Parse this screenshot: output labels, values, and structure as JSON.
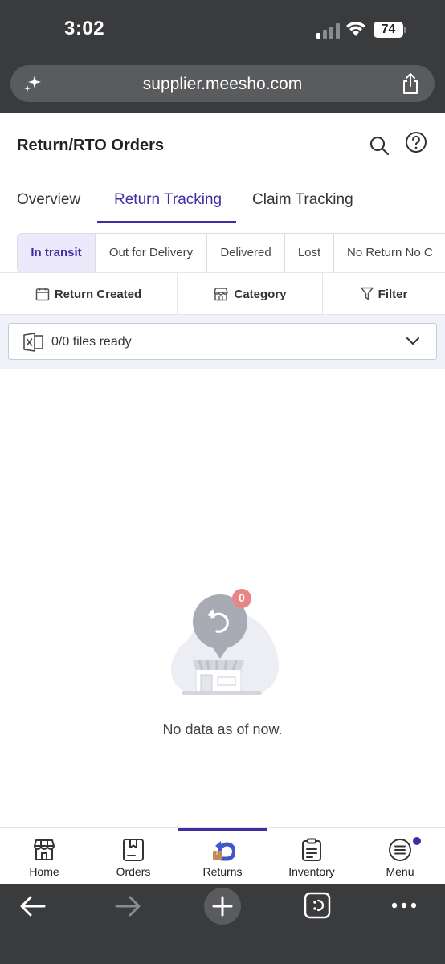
{
  "status_bar": {
    "time": "3:02",
    "battery": "74"
  },
  "browser": {
    "url": "supplier.meesho.com"
  },
  "header": {
    "title": "Return/RTO Orders"
  },
  "main_tabs": [
    {
      "label": "Overview",
      "active": false
    },
    {
      "label": "Return Tracking",
      "active": true
    },
    {
      "label": "Claim Tracking",
      "active": false
    }
  ],
  "status_chips": [
    {
      "label": "In transit",
      "active": true
    },
    {
      "label": "Out for Delivery",
      "active": false
    },
    {
      "label": "Delivered",
      "active": false
    },
    {
      "label": "Lost",
      "active": false
    },
    {
      "label": "No Return No C",
      "active": false
    }
  ],
  "filters": {
    "return_created": "Return Created",
    "category": "Category",
    "filter": "Filter"
  },
  "files": {
    "status": "0/0 files ready"
  },
  "empty_state": {
    "badge_count": "0",
    "message": "No data as of now."
  },
  "bottom_nav": [
    {
      "label": "Home",
      "icon": "storefront-icon"
    },
    {
      "label": "Orders",
      "icon": "orders-icon"
    },
    {
      "label": "Returns",
      "icon": "returns-icon",
      "active": true
    },
    {
      "label": "Inventory",
      "icon": "clipboard-icon"
    },
    {
      "label": "Menu",
      "icon": "menu-icon",
      "has_notification": true
    }
  ],
  "colors": {
    "accent": "#3d2fa3",
    "chip_active_bg": "#ece9fa",
    "browser_chrome": "#3a3b3d"
  }
}
